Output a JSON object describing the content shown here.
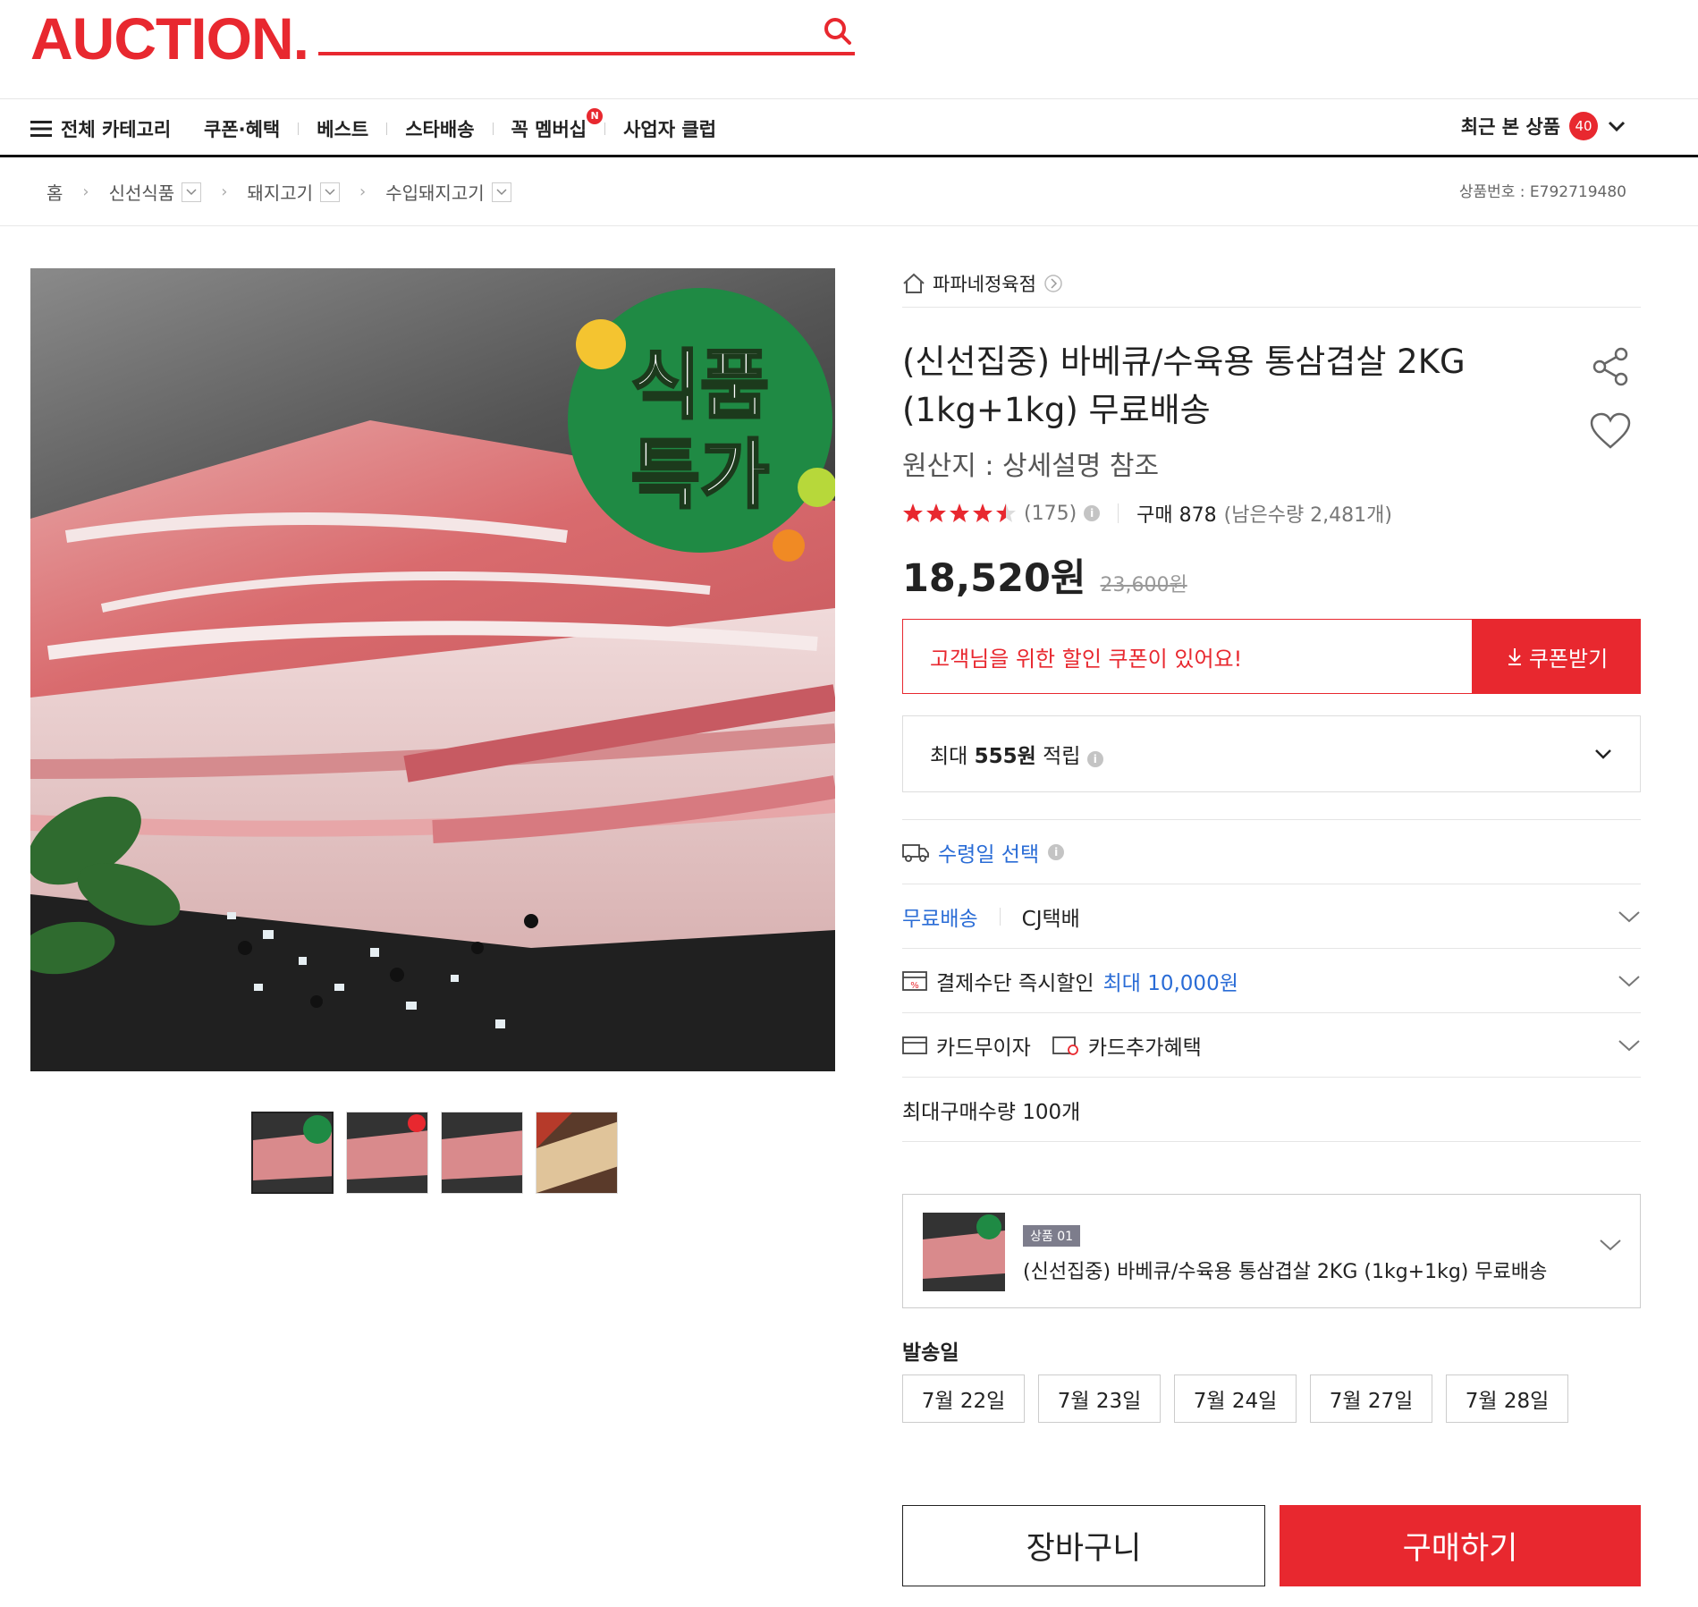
{
  "header": {
    "logo": "AUCTION.",
    "search_placeholder": "",
    "all_categories": "전체 카테고리",
    "menu": [
      "쿠폰·혜택",
      "베스트",
      "스타배송",
      "꼭 멤버십",
      "사업자 클럽"
    ],
    "membership_badge": "N",
    "recent_label": "최근 본 상품",
    "recent_count": "40"
  },
  "breadcrumb": {
    "home": "홈",
    "items": [
      "신선식품",
      "돼지고기",
      "수입돼지고기"
    ],
    "product_no": "상품번호 : E792719480"
  },
  "image": {
    "badge_line1": "식품",
    "badge_line2": "특가"
  },
  "product": {
    "store": "파파네정육점",
    "title": "(신선집중) 바베큐/수육용 통삼겹살 2KG (1kg+1kg) 무료배송",
    "origin": "원산지 : 상세설명 참조",
    "stars": 4.5,
    "review_count": "(175)",
    "purchase": "구매 878",
    "remaining": "(남은수량 2,481개)",
    "price": "18,520원",
    "original_price": "23,600원",
    "coupon_msg": "고객님을 위한 할인 쿠폰이 있어요!",
    "coupon_btn": "쿠폰받기",
    "reward_prefix": "최대 ",
    "reward_amount": "555원",
    "reward_suffix": " 적립",
    "receive_date": "수령일 선택",
    "free_ship": "무료배송",
    "courier": "CJ택배",
    "payment_discount": "결제수단 즉시할인",
    "payment_discount_max": "최대 10,000원",
    "card_installment": "카드무이자",
    "card_benefit": "카드추가혜택",
    "max_qty": "최대구매수량 100개",
    "option_tag": "상품 01",
    "option_name": "(신선집중) 바베큐/수육용 통삼겹살 2KG (1kg+1kg) 무료배송",
    "ship_date_label": "발송일",
    "dates": [
      "7월 22일",
      "7월 23일",
      "7월 24일",
      "7월 27일",
      "7월 28일"
    ],
    "cart": "장바구니",
    "buy": "구매하기"
  },
  "colors": {
    "accent": "#e8282f",
    "link": "#2a6cd6",
    "badge_green": "#1f8a44"
  }
}
